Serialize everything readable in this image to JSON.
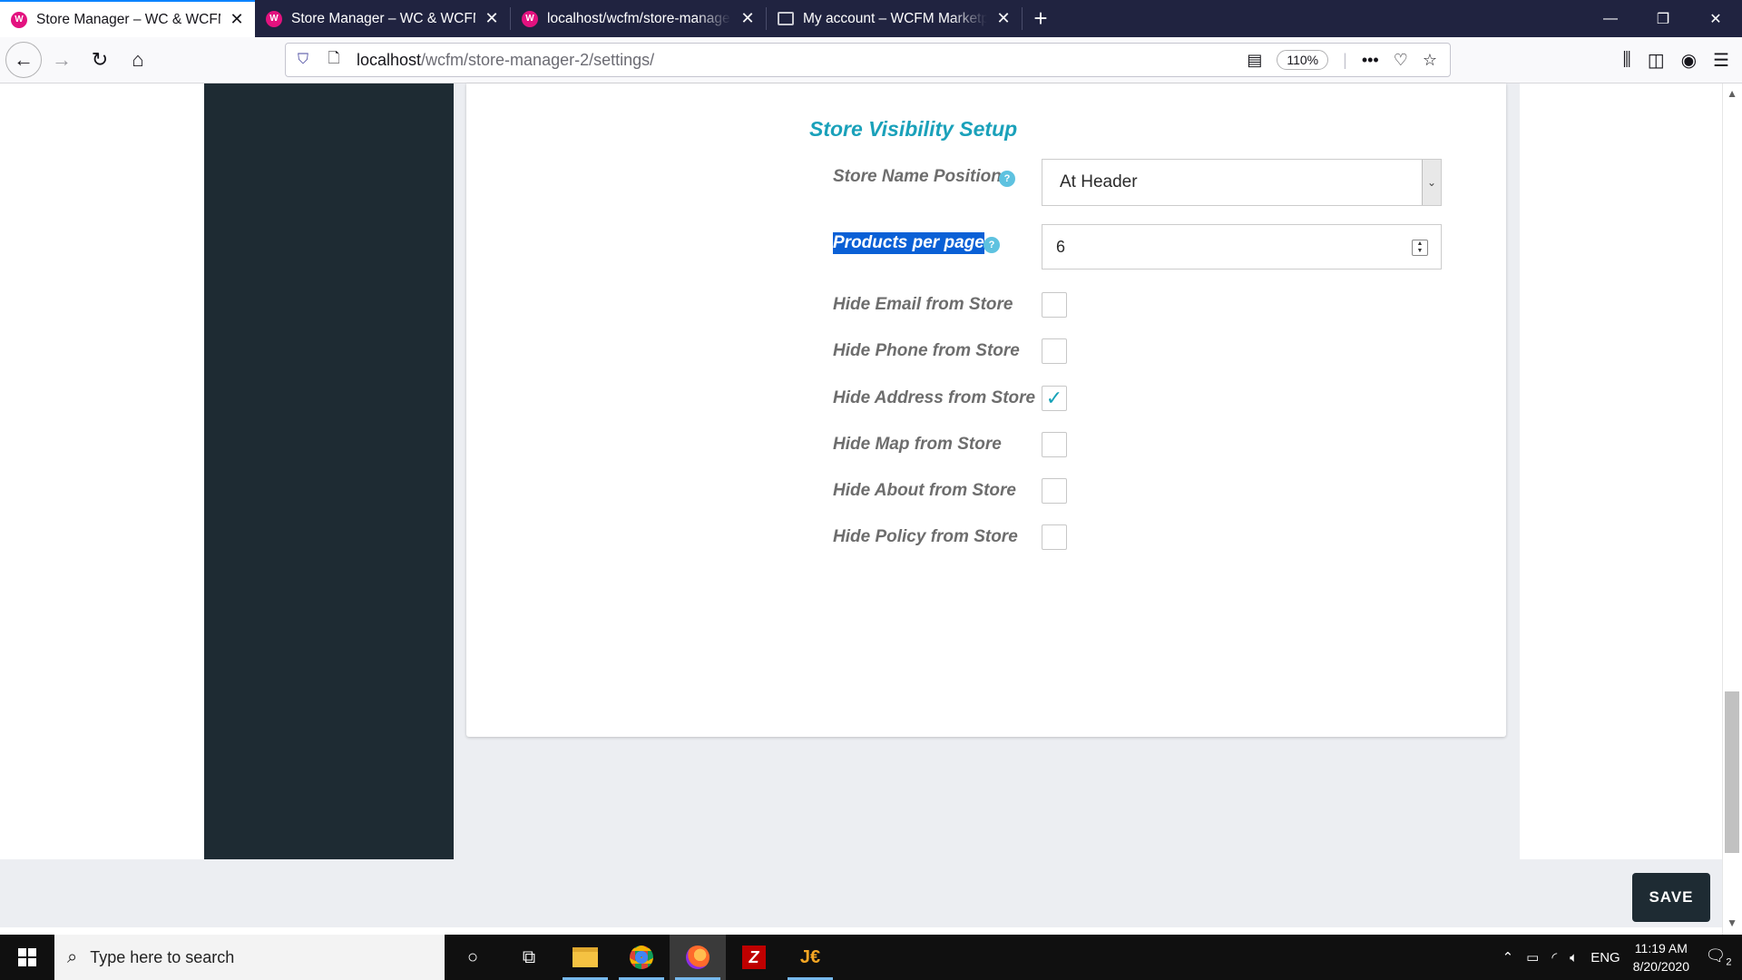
{
  "browser": {
    "tabs": [
      {
        "label": "Store Manager – WC & WCFM",
        "active": true
      },
      {
        "label": "Store Manager – WC & WCFM",
        "active": false
      },
      {
        "label": "localhost/wcfm/store-manager",
        "active": false
      },
      {
        "label": "My account – WCFM Marketpla",
        "active": false
      }
    ],
    "new_tab": "+",
    "url_host": "localhost",
    "url_path": "/wcfm/store-manager-2/settings/",
    "zoom": "110%",
    "more": "•••"
  },
  "settings": {
    "section_title": "Store Visibility Setup",
    "store_name_position": {
      "label": "Store Name Position",
      "value": "At Header"
    },
    "products_per_page": {
      "label": "Products per page",
      "value": "6"
    },
    "checkboxes": [
      {
        "label": "Hide Email from Store",
        "checked": false
      },
      {
        "label": "Hide Phone from Store",
        "checked": false
      },
      {
        "label": "Hide Address from Store",
        "checked": true
      },
      {
        "label": "Hide Map from Store",
        "checked": false
      },
      {
        "label": "Hide About from Store",
        "checked": false
      },
      {
        "label": "Hide Policy from Store",
        "checked": false
      }
    ],
    "save_label": "SAVE"
  },
  "taskbar": {
    "search_placeholder": "Type here to search",
    "language": "ENG",
    "time": "11:19 AM",
    "date": "8/20/2020",
    "notification_count": "2"
  },
  "colors": {
    "accent": "#1aa1ba",
    "sidebar": "#1e2b33",
    "tabbar": "#202340"
  }
}
